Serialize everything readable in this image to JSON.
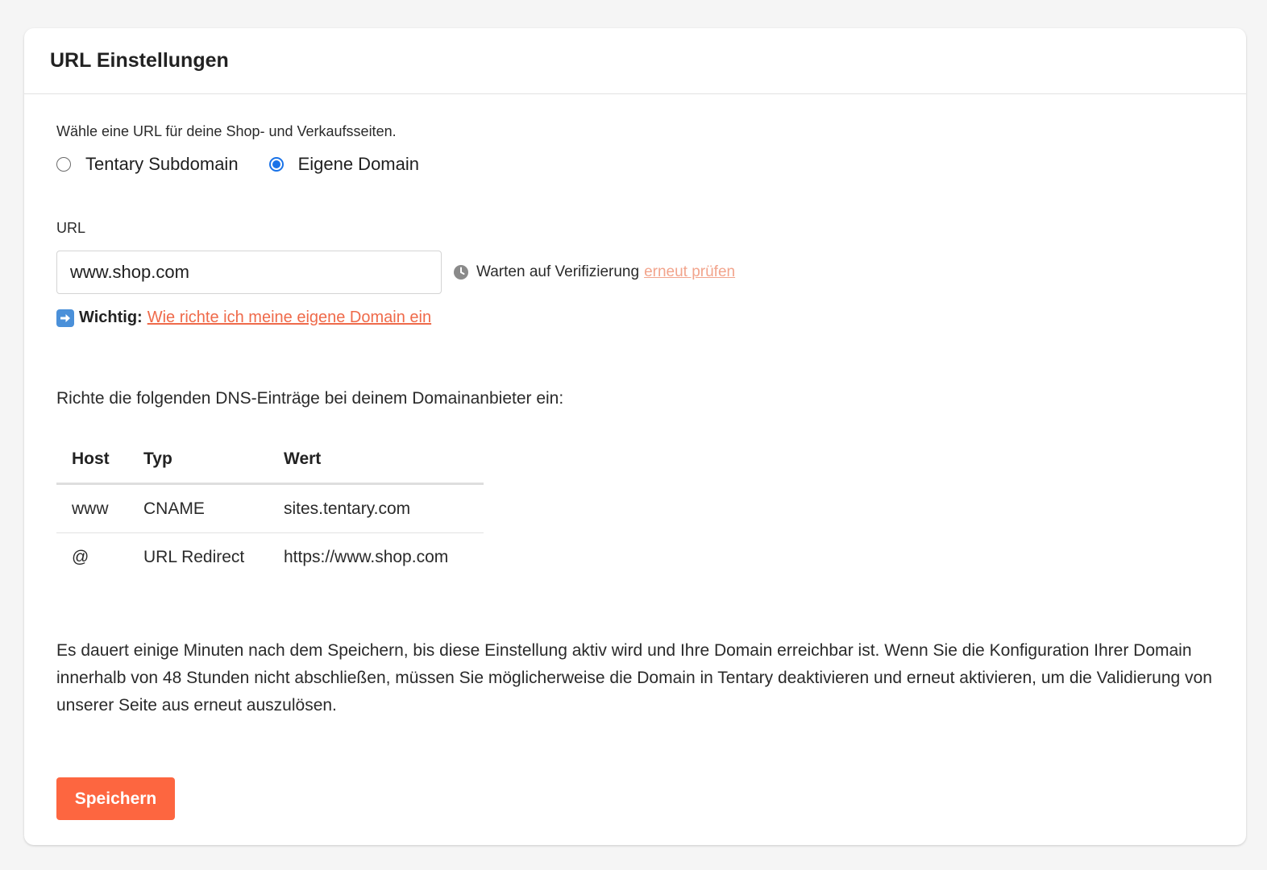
{
  "header": {
    "title": "URL Einstellungen"
  },
  "url_choice": {
    "intro": "Wähle eine URL für deine Shop- und Verkaufsseiten.",
    "options": [
      {
        "label": "Tentary Subdomain",
        "checked": false
      },
      {
        "label": "Eigene Domain",
        "checked": true
      }
    ]
  },
  "url_field": {
    "label": "URL",
    "value": "www.shop.com"
  },
  "verification": {
    "icon": "clock-icon",
    "status": "Warten auf Verifizierung",
    "retry_link": "erneut prüfen"
  },
  "important": {
    "icon": "arrow-right-icon",
    "label": "Wichtig:",
    "link": "Wie richte ich meine eigene Domain ein"
  },
  "dns": {
    "intro": "Richte die folgenden DNS-Einträge bei deinem Domainanbieter ein:",
    "headers": [
      "Host",
      "Typ",
      "Wert"
    ],
    "rows": [
      [
        "www",
        "CNAME",
        "sites.tentary.com"
      ],
      [
        "@",
        "URL Redirect",
        "https://www.shop.com"
      ]
    ]
  },
  "notice": "Es dauert einige Minuten nach dem Speichern, bis diese Einstellung aktiv wird und Ihre Domain erreichbar ist. Wenn Sie die Konfiguration Ihrer Domain innerhalb von 48 Stunden nicht abschließen, müssen Sie möglicherweise die Domain in Tentary deaktivieren und erneut aktivieren, um die Validierung von unserer Seite aus erneut auszulösen.",
  "actions": {
    "save_label": "Speichern"
  },
  "colors": {
    "accent": "#fd6640",
    "link": "#ef6a4a",
    "radio_checked": "#1a73e8"
  }
}
